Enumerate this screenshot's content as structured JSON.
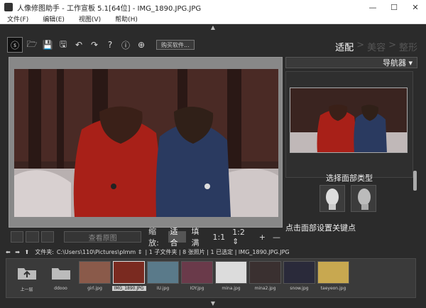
{
  "window": {
    "title": "人像修图助手 - 工作宣板 5.1[64位] - IMG_1890.JPG.JPG",
    "min": "—",
    "max": "☐",
    "close": "✕"
  },
  "menu": [
    "文件(F)",
    "编辑(E)",
    "视图(V)",
    "帮助(H)"
  ],
  "toolbar": {
    "logo": "ⓢ",
    "icons": [
      "open-folder-icon",
      "save-icon",
      "save-as-icon",
      "undo-icon",
      "redo-icon",
      "help-icon",
      "info-icon",
      "plugin-icon"
    ],
    "glyphs": [
      "🗁",
      "💾",
      "🖫",
      "↶",
      "↷",
      "?",
      "ⓘ",
      "⊕"
    ],
    "buy_label": "购买软件..."
  },
  "steps": [
    {
      "label": "适配",
      "active": true
    },
    {
      "label": ">",
      "active": false
    },
    {
      "label": "美容",
      "active": false
    },
    {
      "label": ">",
      "active": false
    },
    {
      "label": "整形",
      "active": false
    }
  ],
  "view": {
    "compare_label": "查看原图",
    "zoom_label": "缩放:",
    "zoom_options": [
      {
        "label": "适合",
        "selected": true
      },
      {
        "label": "填满",
        "selected": false
      },
      {
        "label": "1:1",
        "selected": false
      },
      {
        "label": "1:2 ⇕",
        "selected": false
      },
      {
        "label": "+",
        "selected": false
      },
      {
        "label": "—",
        "selected": false
      }
    ]
  },
  "navigator": {
    "title": "导航器 ▾",
    "face_label": "选择面部类型",
    "keypoint_label": "点击面部设置关键点"
  },
  "path": {
    "nav": "⬅ ➡ ⬆",
    "label": "文件夹:",
    "value": "C:\\Users\\110\\Pictures\\plmm ⇕",
    "status": "| 1 子文件夹 | 8 张照片 | 1 已选定 | IMG_1890.JPG.JPG"
  },
  "thumbs": [
    {
      "name": "上一层",
      "kind": "up"
    },
    {
      "name": "ddooo",
      "kind": "folder"
    },
    {
      "name": "girl.jpg",
      "kind": "photo",
      "color": "#8a5a4a"
    },
    {
      "name": "IMG_1890.JPG",
      "kind": "photo",
      "color": "#7a2a20",
      "selected": true
    },
    {
      "name": "IU.jpg",
      "kind": "photo",
      "color": "#5a7a8a"
    },
    {
      "name": "IOY.jpg",
      "kind": "photo",
      "color": "#6a3a4a"
    },
    {
      "name": "mina.jpg",
      "kind": "photo",
      "color": "#dcdcdc"
    },
    {
      "name": "mina2.jpg",
      "kind": "photo",
      "color": "#3a3030"
    },
    {
      "name": "snow.jpg",
      "kind": "photo",
      "color": "#2a2a3a"
    },
    {
      "name": "taeyeon.jpg",
      "kind": "photo",
      "color": "#c8a850"
    }
  ]
}
